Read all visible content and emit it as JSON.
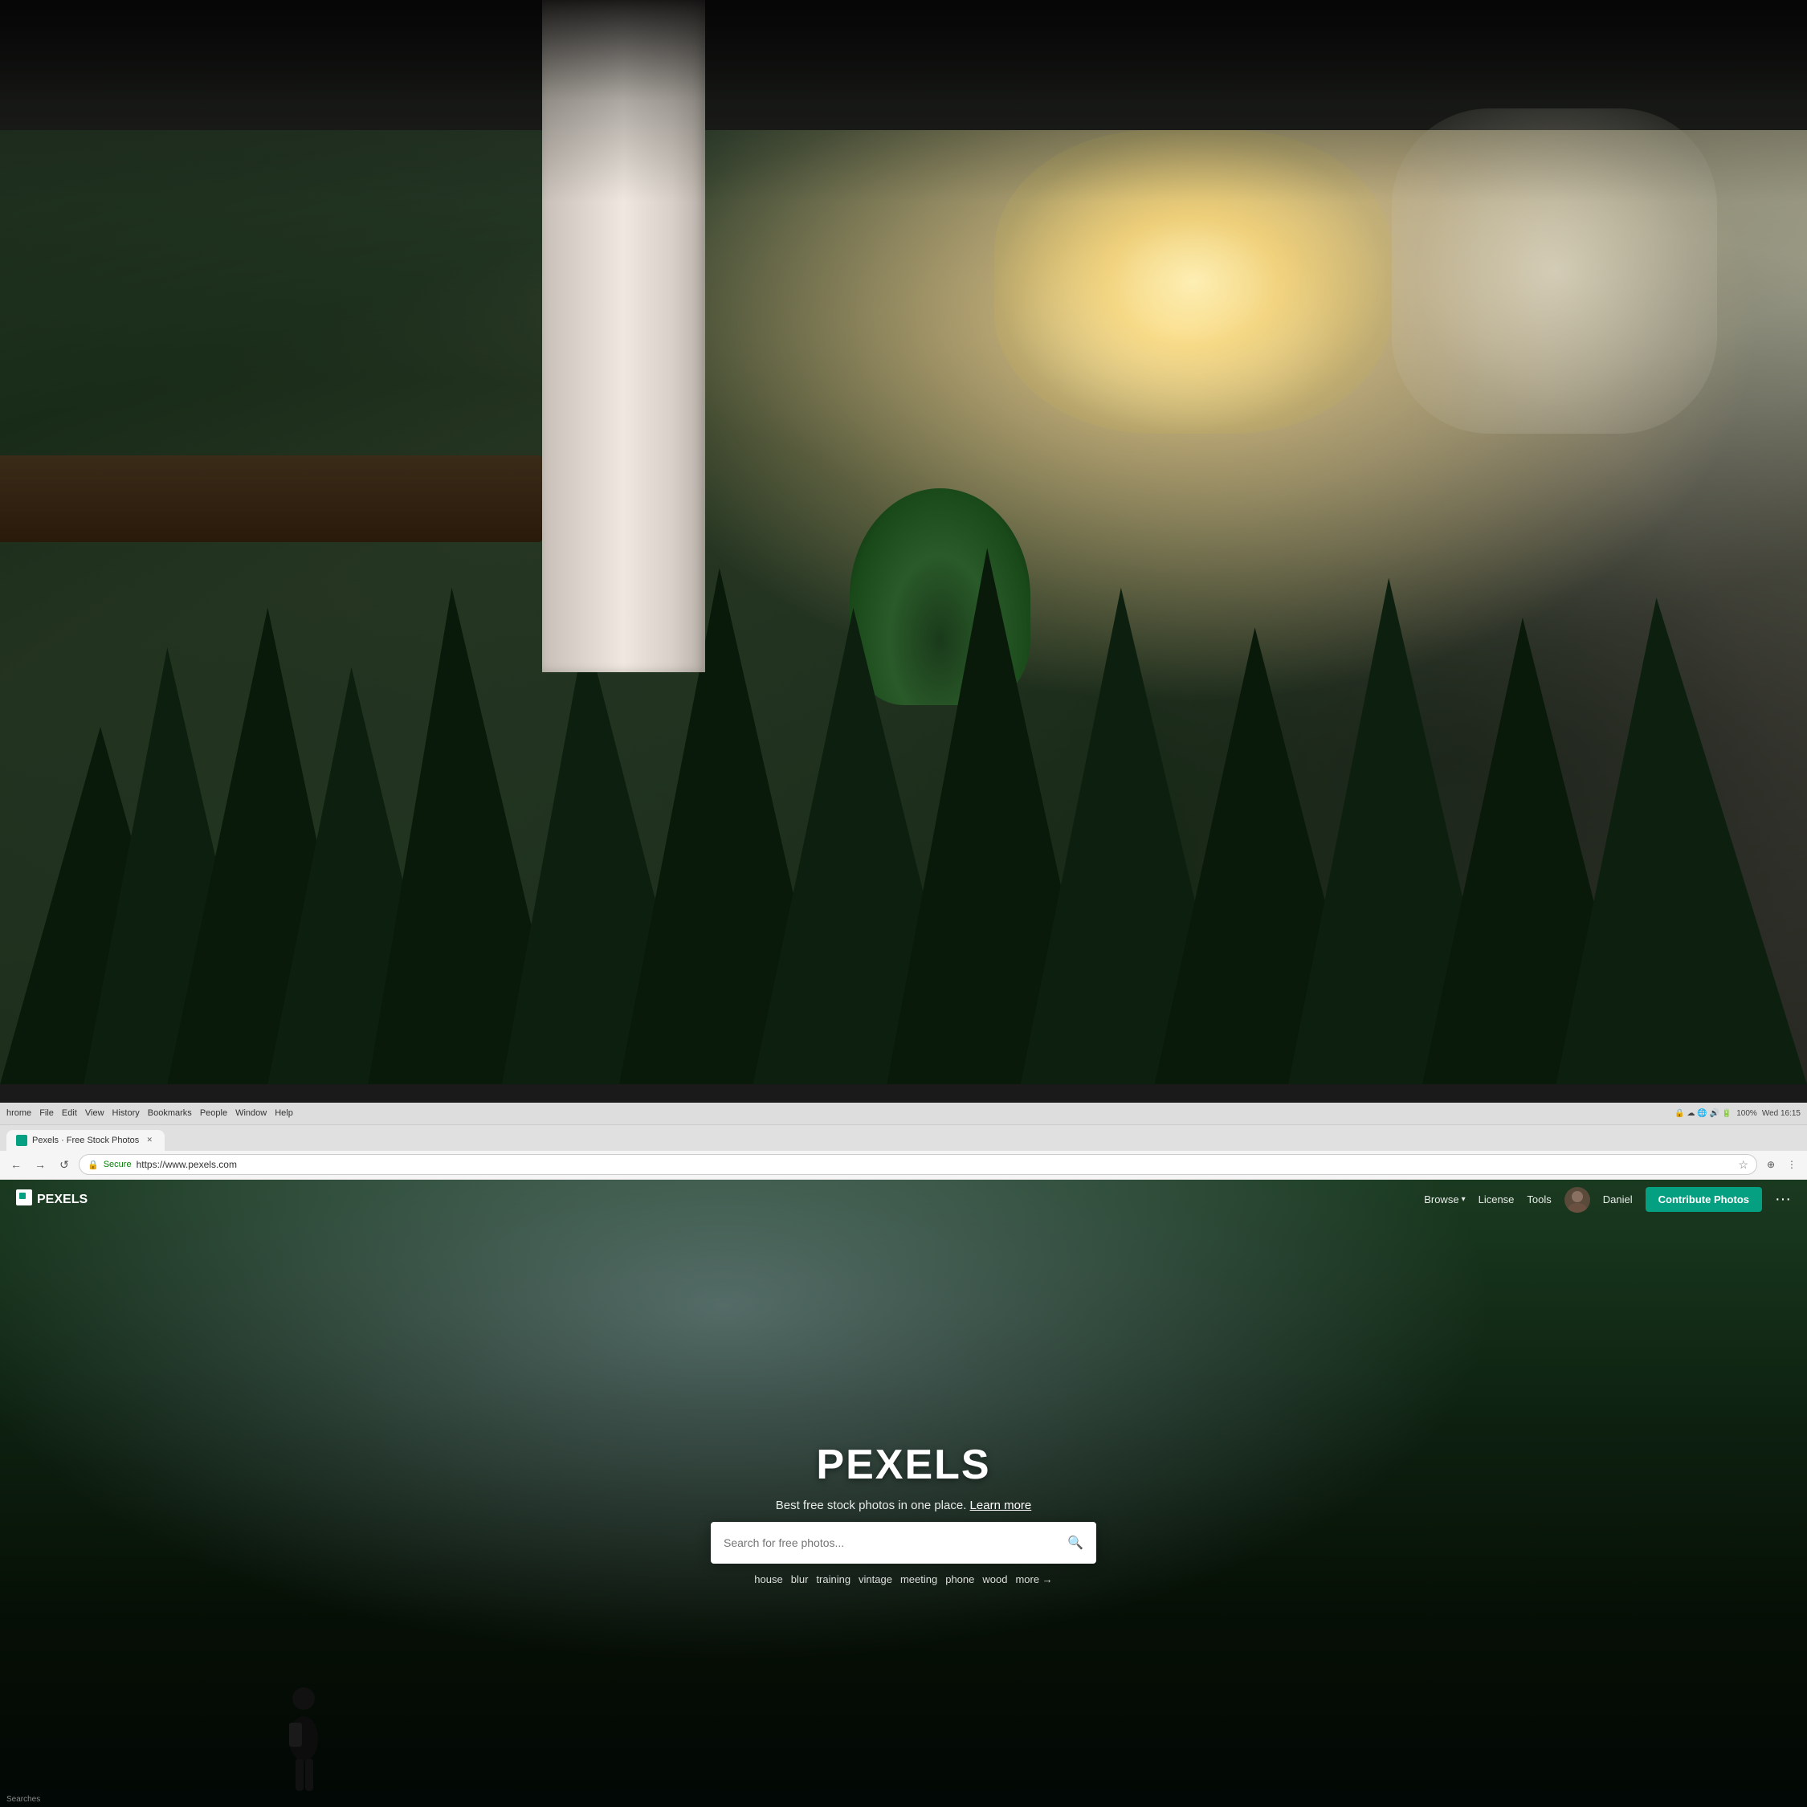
{
  "photo": {
    "description": "Office interior with blurred background, person in foreground using laptop showing Pexels website"
  },
  "os_bar": {
    "menu_items": [
      "hrome",
      "File",
      "Edit",
      "View",
      "History",
      "Bookmarks",
      "People",
      "Window",
      "Help"
    ],
    "time": "Wed 16:15",
    "battery": "100%"
  },
  "tab": {
    "label": "Pexels · Free Stock Photos",
    "favicon": "P"
  },
  "address_bar": {
    "protocol": "Secure",
    "url": "https://www.pexels.com",
    "back_label": "←",
    "forward_label": "→",
    "refresh_label": "↺"
  },
  "pexels": {
    "nav": {
      "browse_label": "Browse",
      "license_label": "License",
      "tools_label": "Tools",
      "user_label": "Daniel",
      "contribute_label": "Contribute Photos",
      "more_label": "···"
    },
    "hero": {
      "title": "PEXELS",
      "subtitle": "Best free stock photos in one place.",
      "learn_more": "Learn more",
      "search_placeholder": "Search for free photos...",
      "tags": [
        "house",
        "blur",
        "training",
        "vintage",
        "meeting",
        "phone",
        "wood"
      ],
      "tags_more": "more →"
    }
  },
  "bottom_bar": {
    "search_label": "Searches"
  }
}
